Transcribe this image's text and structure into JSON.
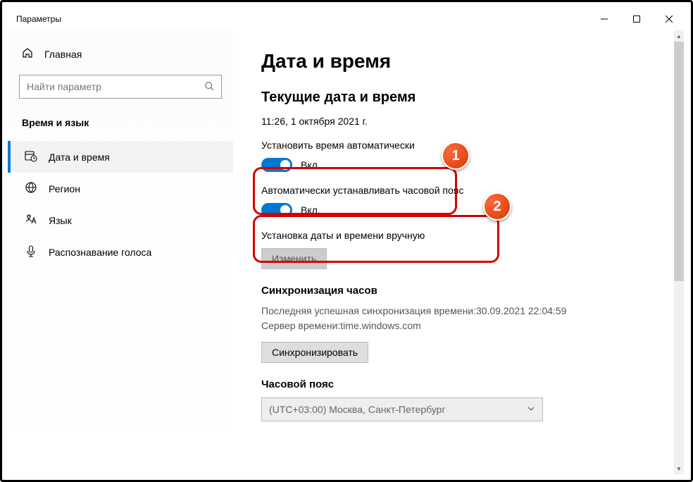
{
  "window": {
    "title": "Параметры"
  },
  "sidebar": {
    "home": "Главная",
    "search_placeholder": "Найти параметр",
    "category": "Время и язык",
    "items": [
      {
        "label": "Дата и время"
      },
      {
        "label": "Регион"
      },
      {
        "label": "Язык"
      },
      {
        "label": "Распознавание голоса"
      }
    ]
  },
  "main": {
    "title": "Дата и время",
    "subtitle": "Текущие дата и время",
    "current_datetime": "11:26, 1 октября 2021 г.",
    "auto_time": {
      "label": "Установить время автоматически",
      "state": "Вкл."
    },
    "auto_tz": {
      "label": "Автоматически устанавливать часовой пояс",
      "state": "Вкл."
    },
    "manual": {
      "label": "Установка даты и времени вручную",
      "button": "Изменить"
    },
    "sync": {
      "heading": "Синхронизация часов",
      "last_sync_label": "Последняя успешная синхронизация времени:",
      "last_sync_value": "30.09.2021 22:04:59",
      "server_label": "Сервер времени:",
      "server_value": "time.windows.com",
      "button": "Синхронизировать"
    },
    "timezone": {
      "heading": "Часовой пояс",
      "value": "(UTC+03:00) Москва, Санкт-Петербург"
    }
  },
  "annotations": {
    "badge1": "1",
    "badge2": "2"
  }
}
